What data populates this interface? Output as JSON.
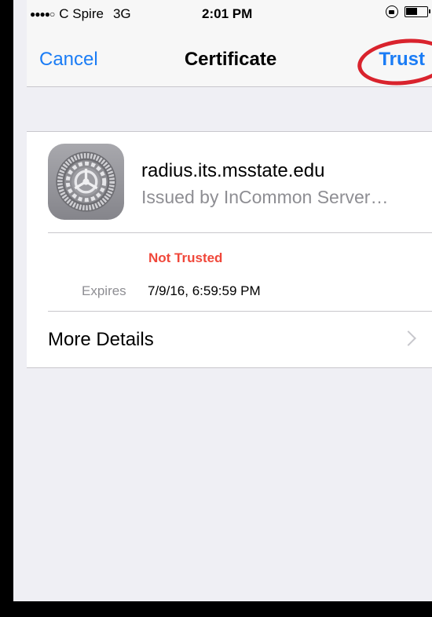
{
  "status_bar": {
    "carrier": "C Spire",
    "network": "3G",
    "time": "2:01 PM",
    "signal_glyph": "●●●●○",
    "icons": [
      "signal-dots-icon",
      "orientation-lock-icon",
      "battery-icon"
    ]
  },
  "nav": {
    "cancel_label": "Cancel",
    "title": "Certificate",
    "trust_label": "Trust"
  },
  "certificate": {
    "name": "radius.its.msstate.edu",
    "issuer": "Issued by InCommon Server…",
    "icon": "settings-gear-icon",
    "status": "Not Trusted",
    "expires_label": "Expires",
    "expires_value": "7/9/16, 6:59:59 PM"
  },
  "more_details": {
    "label": "More Details",
    "icon": "chevron-right-icon"
  },
  "colors": {
    "accent": "#1a7cf5",
    "warning": "#f0473a",
    "annotation": "#d9232d"
  }
}
